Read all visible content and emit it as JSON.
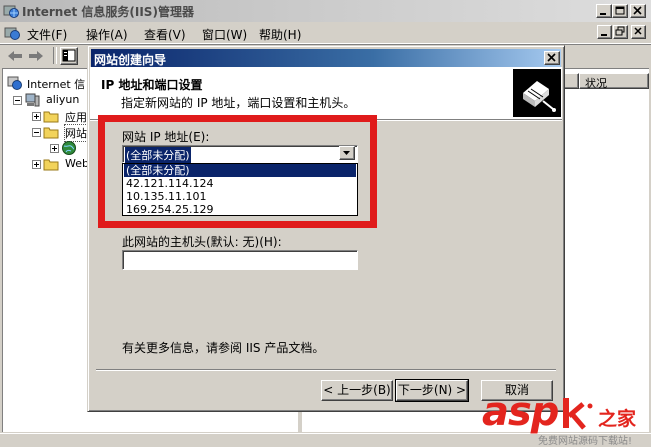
{
  "window": {
    "title": "Internet 信息服务(IIS)管理器",
    "app_icon": "iis-icon",
    "controls": [
      "minimize-icon",
      "maximize-icon",
      "close-icon"
    ]
  },
  "menu": {
    "icon": "iis-icon",
    "items": [
      {
        "label": "文件(F)"
      },
      {
        "label": "操作(A)"
      },
      {
        "label": "查看(V)"
      },
      {
        "label": "窗口(W)"
      },
      {
        "label": "帮助(H)"
      }
    ],
    "mdi_controls": [
      "minimize-icon",
      "restore-icon",
      "close-icon"
    ]
  },
  "toolbar": {
    "icons": [
      "back-arrow-icon",
      "forward-arrow-icon",
      "console-tree-icon"
    ]
  },
  "tree": {
    "items": [
      {
        "label": "Internet 信",
        "icon": "iis-globe-icon"
      },
      {
        "label": "aliyun",
        "icon": "server-icon"
      },
      {
        "label": "应用",
        "icon": "folder-icon"
      },
      {
        "label": "网站",
        "icon": "folder-icon"
      },
      {
        "label": "",
        "icon": "globe-icon"
      },
      {
        "label": "Web",
        "icon": "folder-icon"
      }
    ]
  },
  "list": {
    "columns": [
      "状况"
    ]
  },
  "dialog": {
    "title": "网站创建向导",
    "heading": "IP 地址和端口设置",
    "subheading": "指定新网站的 IP 地址，端口设置和主机头。",
    "wizard_icon": "wizard-book-icon",
    "ip_label": "网站 IP 地址(E):",
    "ip_selected": "(全部未分配)",
    "ip_options": [
      "(全部未分配)",
      "42.121.114.124",
      "10.135.11.101",
      "169.254.25.129"
    ],
    "host_label": "此网站的主机头(默认: 无)(H):",
    "host_value": "",
    "info": "有关更多信息，请参阅 IIS 产品文档。",
    "buttons": {
      "back": "< 上一步(B)",
      "next": "下一步(N) >",
      "cancel": "取消"
    }
  },
  "colors": {
    "highlight": "#e01b1b",
    "selection": "#0a246a",
    "watermark": "#e3251e"
  },
  "watermark": {
    "brand": "asp",
    "brand_suffix": "之家",
    "tagline": "免费网站源码下载站!"
  }
}
